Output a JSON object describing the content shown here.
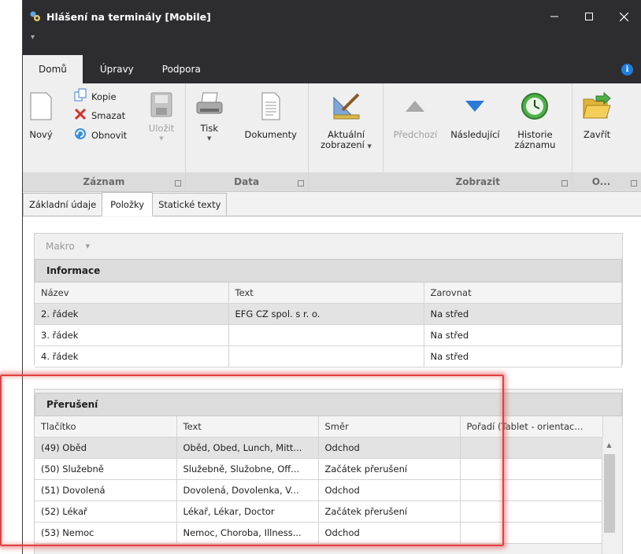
{
  "window": {
    "title": "Hlášení na terminály [Mobile]",
    "qat_arrow": "▾"
  },
  "ribbon_tabs": [
    "Domů",
    "Úpravy",
    "Podpora"
  ],
  "ribbon": {
    "record": {
      "label": "Záznam",
      "new": "Nový",
      "copy": "Kopie",
      "delete": "Smazat",
      "refresh": "Obnovit",
      "save": "Uložit"
    },
    "data": {
      "label": "Data",
      "print": "Tisk",
      "documents": "Dokumenty"
    },
    "current": {
      "line1": "Aktuální",
      "line2": "zobrazení"
    },
    "show": {
      "label": "Zobrazit",
      "previous": "Předchozí",
      "next": "Následující",
      "history_line1": "Historie",
      "history_line2": "záznamu"
    },
    "other": {
      "label": "O...",
      "close": "Zavřít"
    }
  },
  "form_tabs": [
    "Základní údaje",
    "Položky",
    "Statické texty"
  ],
  "macro": {
    "label": "Makro"
  },
  "info": {
    "title": "Informace",
    "columns": [
      "Název",
      "Text",
      "Zarovnat"
    ],
    "rows": [
      [
        "2. řádek",
        "EFG CZ spol. s r. o.",
        "Na střed"
      ],
      [
        "3. řádek",
        "",
        "Na střed"
      ],
      [
        "4. řádek",
        "",
        "Na střed"
      ]
    ]
  },
  "breaks": {
    "title": "Přerušení",
    "columns": [
      "Tlačítko",
      "Text",
      "Směr",
      "Pořadí (Tablet - orientac..."
    ],
    "rows": [
      [
        "(49) Oběd",
        "Oběd, Obed, Lunch, Mitt...",
        "Odchod",
        ""
      ],
      [
        "(50) Služebně",
        "Služebně, Služobne, Off...",
        "Začátek přerušení",
        ""
      ],
      [
        "(51) Dovolená",
        "Dovolená, Dovolenka, V...",
        "Odchod",
        ""
      ],
      [
        "(52) Lékař",
        "Lékař, Lékar, Doctor",
        "Začátek přerušení",
        ""
      ],
      [
        "(53) Nemoc",
        "Nemoc, Choroba, Illness...",
        "Odchod",
        ""
      ]
    ]
  },
  "colors": {
    "titlebar": "#2d2d30",
    "accent_blue": "#1f7de0",
    "highlight": "#e04040"
  }
}
